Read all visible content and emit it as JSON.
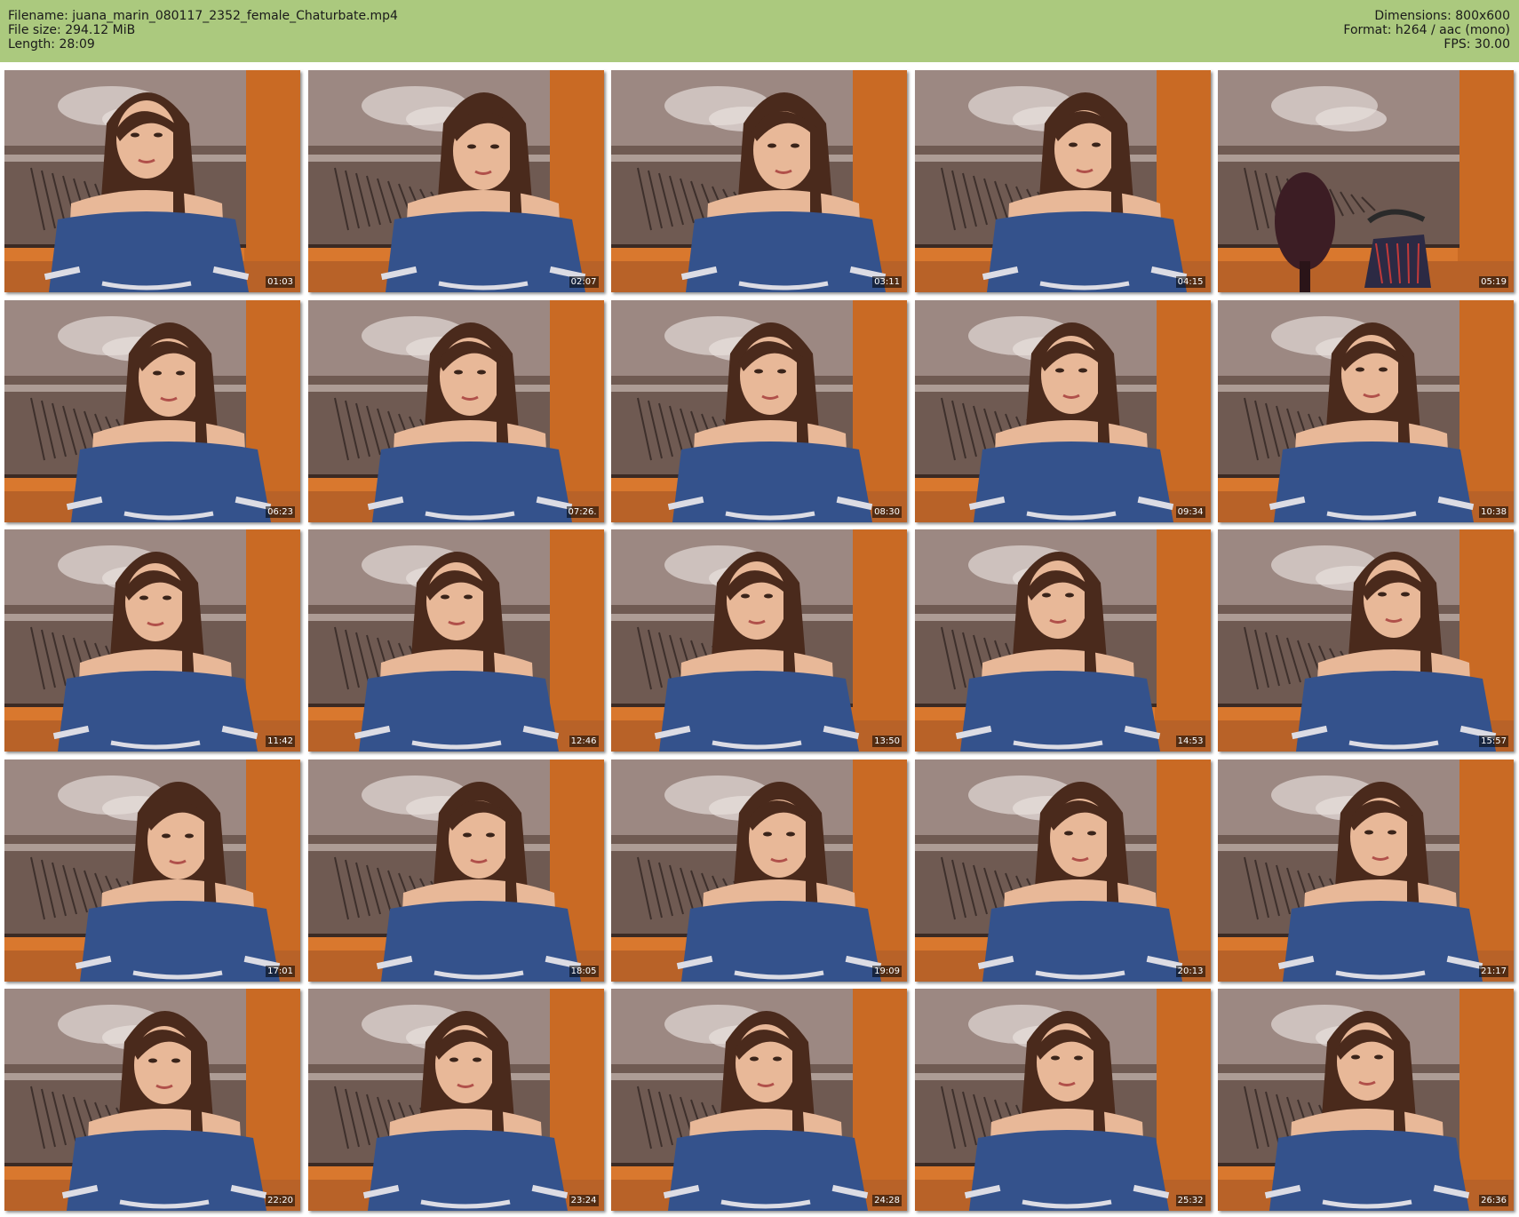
{
  "header": {
    "filename_line": "Filename: juana_marin_080117_2352_female_Chaturbate.mp4",
    "filesize_line": "File size: 294.12 MiB",
    "length_line": "Length: 28:09",
    "dimensions_line": "Dimensions: 800x600",
    "format_line": "Format: h264 / aac (mono)",
    "fps_line": "FPS: 30.00"
  },
  "colors": {
    "header_bg": "#abc97e",
    "wall_orange": "#d9782e",
    "dress_blue": "#34528c",
    "hair_brown": "#4a2a1c",
    "skin": "#e8b898"
  },
  "thumbnails": [
    {
      "timestamp": "01:03",
      "variant": "person"
    },
    {
      "timestamp": "02:07",
      "variant": "person"
    },
    {
      "timestamp": "03:11",
      "variant": "person"
    },
    {
      "timestamp": "04:15",
      "variant": "person"
    },
    {
      "timestamp": "05:19",
      "variant": "empty-chair"
    },
    {
      "timestamp": "06:23",
      "variant": "person"
    },
    {
      "timestamp": "07:26.",
      "variant": "person"
    },
    {
      "timestamp": "08:30",
      "variant": "person"
    },
    {
      "timestamp": "09:34",
      "variant": "person"
    },
    {
      "timestamp": "10:38",
      "variant": "person"
    },
    {
      "timestamp": "11:42",
      "variant": "person"
    },
    {
      "timestamp": "12:46",
      "variant": "person"
    },
    {
      "timestamp": "13:50",
      "variant": "person"
    },
    {
      "timestamp": "14:53",
      "variant": "person"
    },
    {
      "timestamp": "15:57",
      "variant": "person"
    },
    {
      "timestamp": "17:01",
      "variant": "person"
    },
    {
      "timestamp": "18:05",
      "variant": "person"
    },
    {
      "timestamp": "19:09",
      "variant": "person"
    },
    {
      "timestamp": "20:13",
      "variant": "person"
    },
    {
      "timestamp": "21:17",
      "variant": "person"
    },
    {
      "timestamp": "22:20",
      "variant": "person"
    },
    {
      "timestamp": "23:24",
      "variant": "person"
    },
    {
      "timestamp": "24:28",
      "variant": "person"
    },
    {
      "timestamp": "25:32",
      "variant": "person"
    },
    {
      "timestamp": "26:36",
      "variant": "person"
    }
  ]
}
